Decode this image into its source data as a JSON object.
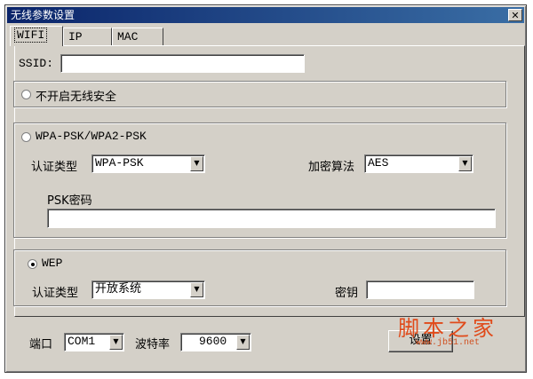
{
  "window": {
    "title": "无线参数设置",
    "close_glyph": "✕"
  },
  "tabs": [
    {
      "label": "WIFI",
      "active": true
    },
    {
      "label": "IP",
      "active": false
    },
    {
      "label": "MAC",
      "active": false
    }
  ],
  "ssid": {
    "label": "SSID:",
    "value": ""
  },
  "security": {
    "none": {
      "label": "不开启无线安全",
      "selected": false
    },
    "wpa": {
      "label": "WPA-PSK/WPA2-PSK",
      "selected": false,
      "auth_label": "认证类型",
      "auth_value": "WPA-PSK",
      "cipher_label": "加密算法",
      "cipher_value": "AES",
      "psk_label": "PSK密码",
      "psk_value": ""
    },
    "wep": {
      "label": "WEP",
      "selected": true,
      "auth_label": "认证类型",
      "auth_value": "开放系统",
      "key_label": "密钥",
      "key_value": ""
    }
  },
  "footer": {
    "port_label": "端口",
    "port_value": "COM1",
    "baud_label": "波特率",
    "baud_value": "9600",
    "set_button": "设置"
  },
  "watermark": {
    "brand": "脚本之家",
    "url": "www.jb51.net"
  },
  "icons": {
    "dropdown": "▼"
  }
}
